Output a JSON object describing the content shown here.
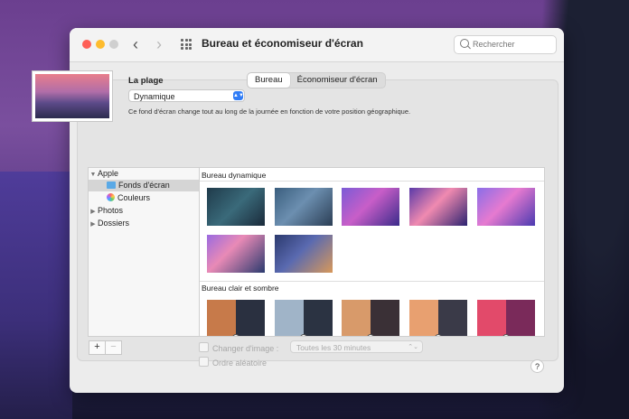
{
  "window": {
    "title": "Bureau et économiseur d'écran",
    "search_placeholder": "Rechercher"
  },
  "tabs": [
    {
      "label": "Bureau",
      "active": true
    },
    {
      "label": "Économiseur d'écran",
      "active": false
    }
  ],
  "wallpaper": {
    "label": "La plage",
    "mode_selected": "Dynamique",
    "description": "Ce fond d'écran change tout au long de la journée en fonction de votre position géographique."
  },
  "sidebar": {
    "items": [
      {
        "label": "Apple",
        "expanded": true
      },
      {
        "label": "Fonds d'écran",
        "icon": "folder-icon",
        "selected": true
      },
      {
        "label": "Couleurs",
        "icon": "palette-icon"
      },
      {
        "label": "Photos",
        "expanded": false
      },
      {
        "label": "Dossiers",
        "expanded": false
      }
    ]
  },
  "sections": [
    {
      "title": "Bureau dynamique"
    },
    {
      "title": "Bureau clair et sombre"
    }
  ],
  "options": {
    "change_image": "Changer d'image :",
    "interval": "Toutes les 30 minutes",
    "random_order": "Ordre aléatoire"
  },
  "buttons": {
    "add": "+",
    "remove": "−",
    "help": "?"
  },
  "colors": {
    "accent": "#2f7cf6",
    "selection": "#d5d5d5"
  }
}
